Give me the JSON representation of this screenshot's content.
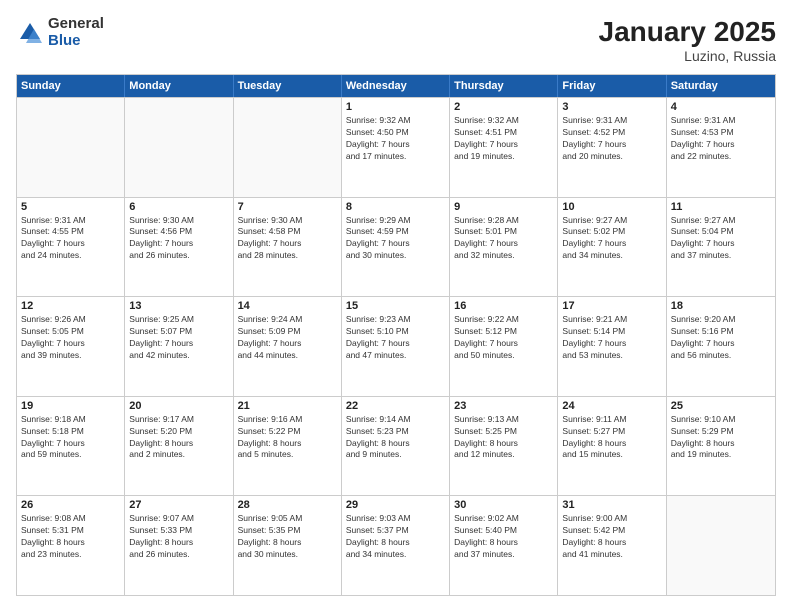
{
  "header": {
    "logo_general": "General",
    "logo_blue": "Blue",
    "title": "January 2025",
    "subtitle": "Luzino, Russia"
  },
  "weekdays": [
    "Sunday",
    "Monday",
    "Tuesday",
    "Wednesday",
    "Thursday",
    "Friday",
    "Saturday"
  ],
  "rows": [
    [
      {
        "day": "",
        "info": ""
      },
      {
        "day": "",
        "info": ""
      },
      {
        "day": "",
        "info": ""
      },
      {
        "day": "1",
        "info": "Sunrise: 9:32 AM\nSunset: 4:50 PM\nDaylight: 7 hours\nand 17 minutes."
      },
      {
        "day": "2",
        "info": "Sunrise: 9:32 AM\nSunset: 4:51 PM\nDaylight: 7 hours\nand 19 minutes."
      },
      {
        "day": "3",
        "info": "Sunrise: 9:31 AM\nSunset: 4:52 PM\nDaylight: 7 hours\nand 20 minutes."
      },
      {
        "day": "4",
        "info": "Sunrise: 9:31 AM\nSunset: 4:53 PM\nDaylight: 7 hours\nand 22 minutes."
      }
    ],
    [
      {
        "day": "5",
        "info": "Sunrise: 9:31 AM\nSunset: 4:55 PM\nDaylight: 7 hours\nand 24 minutes."
      },
      {
        "day": "6",
        "info": "Sunrise: 9:30 AM\nSunset: 4:56 PM\nDaylight: 7 hours\nand 26 minutes."
      },
      {
        "day": "7",
        "info": "Sunrise: 9:30 AM\nSunset: 4:58 PM\nDaylight: 7 hours\nand 28 minutes."
      },
      {
        "day": "8",
        "info": "Sunrise: 9:29 AM\nSunset: 4:59 PM\nDaylight: 7 hours\nand 30 minutes."
      },
      {
        "day": "9",
        "info": "Sunrise: 9:28 AM\nSunset: 5:01 PM\nDaylight: 7 hours\nand 32 minutes."
      },
      {
        "day": "10",
        "info": "Sunrise: 9:27 AM\nSunset: 5:02 PM\nDaylight: 7 hours\nand 34 minutes."
      },
      {
        "day": "11",
        "info": "Sunrise: 9:27 AM\nSunset: 5:04 PM\nDaylight: 7 hours\nand 37 minutes."
      }
    ],
    [
      {
        "day": "12",
        "info": "Sunrise: 9:26 AM\nSunset: 5:05 PM\nDaylight: 7 hours\nand 39 minutes."
      },
      {
        "day": "13",
        "info": "Sunrise: 9:25 AM\nSunset: 5:07 PM\nDaylight: 7 hours\nand 42 minutes."
      },
      {
        "day": "14",
        "info": "Sunrise: 9:24 AM\nSunset: 5:09 PM\nDaylight: 7 hours\nand 44 minutes."
      },
      {
        "day": "15",
        "info": "Sunrise: 9:23 AM\nSunset: 5:10 PM\nDaylight: 7 hours\nand 47 minutes."
      },
      {
        "day": "16",
        "info": "Sunrise: 9:22 AM\nSunset: 5:12 PM\nDaylight: 7 hours\nand 50 minutes."
      },
      {
        "day": "17",
        "info": "Sunrise: 9:21 AM\nSunset: 5:14 PM\nDaylight: 7 hours\nand 53 minutes."
      },
      {
        "day": "18",
        "info": "Sunrise: 9:20 AM\nSunset: 5:16 PM\nDaylight: 7 hours\nand 56 minutes."
      }
    ],
    [
      {
        "day": "19",
        "info": "Sunrise: 9:18 AM\nSunset: 5:18 PM\nDaylight: 7 hours\nand 59 minutes."
      },
      {
        "day": "20",
        "info": "Sunrise: 9:17 AM\nSunset: 5:20 PM\nDaylight: 8 hours\nand 2 minutes."
      },
      {
        "day": "21",
        "info": "Sunrise: 9:16 AM\nSunset: 5:22 PM\nDaylight: 8 hours\nand 5 minutes."
      },
      {
        "day": "22",
        "info": "Sunrise: 9:14 AM\nSunset: 5:23 PM\nDaylight: 8 hours\nand 9 minutes."
      },
      {
        "day": "23",
        "info": "Sunrise: 9:13 AM\nSunset: 5:25 PM\nDaylight: 8 hours\nand 12 minutes."
      },
      {
        "day": "24",
        "info": "Sunrise: 9:11 AM\nSunset: 5:27 PM\nDaylight: 8 hours\nand 15 minutes."
      },
      {
        "day": "25",
        "info": "Sunrise: 9:10 AM\nSunset: 5:29 PM\nDaylight: 8 hours\nand 19 minutes."
      }
    ],
    [
      {
        "day": "26",
        "info": "Sunrise: 9:08 AM\nSunset: 5:31 PM\nDaylight: 8 hours\nand 23 minutes."
      },
      {
        "day": "27",
        "info": "Sunrise: 9:07 AM\nSunset: 5:33 PM\nDaylight: 8 hours\nand 26 minutes."
      },
      {
        "day": "28",
        "info": "Sunrise: 9:05 AM\nSunset: 5:35 PM\nDaylight: 8 hours\nand 30 minutes."
      },
      {
        "day": "29",
        "info": "Sunrise: 9:03 AM\nSunset: 5:37 PM\nDaylight: 8 hours\nand 34 minutes."
      },
      {
        "day": "30",
        "info": "Sunrise: 9:02 AM\nSunset: 5:40 PM\nDaylight: 8 hours\nand 37 minutes."
      },
      {
        "day": "31",
        "info": "Sunrise: 9:00 AM\nSunset: 5:42 PM\nDaylight: 8 hours\nand 41 minutes."
      },
      {
        "day": "",
        "info": ""
      }
    ]
  ]
}
